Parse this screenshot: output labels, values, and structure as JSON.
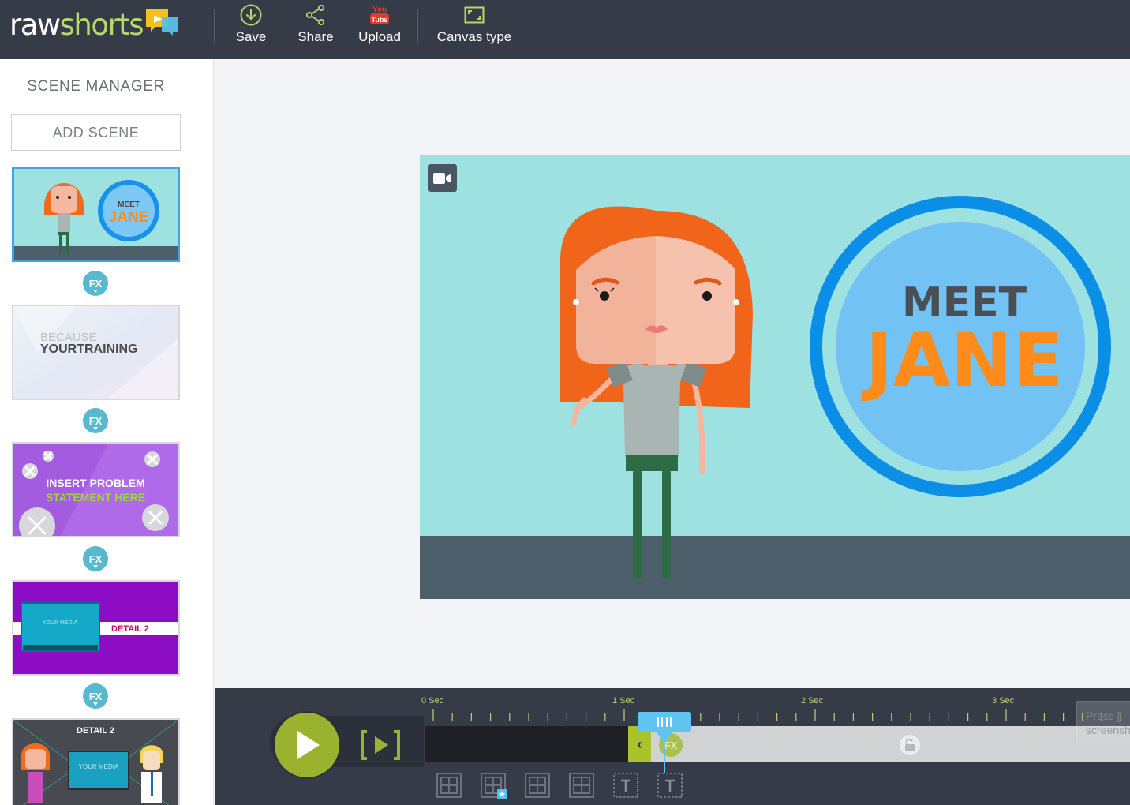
{
  "app": {
    "logo_main": "rawshorts"
  },
  "toolbar": {
    "save_label": "Save",
    "share_label": "Share",
    "upload_label": "Upload",
    "upload_badge": "You Tube",
    "canvas_type_label": "Canvas type",
    "accent_color": "#b8d86a"
  },
  "sidebar": {
    "title": "SCENE MANAGER",
    "add_scene_label": "ADD SCENE",
    "fx_label": "FX",
    "scenes": [
      {
        "thumb_line1": "MEET",
        "thumb_line2": "JANE",
        "selected": true
      },
      {
        "thumb_line1": "BECAUSE",
        "thumb_line2": "YOURTRAINING"
      },
      {
        "thumb_line1": "INSERT PROBLEM",
        "thumb_line2": "STATEMENT HERE"
      },
      {
        "thumb_line1": "YOUR MEDIA",
        "thumb_line2": "DETAIL 2"
      },
      {
        "thumb_line1": "DETAIL 2",
        "thumb_line2": "YOUR MEDIA"
      }
    ]
  },
  "canvas": {
    "headline_small": "MEET",
    "headline_big": "JANE",
    "bg_color": "#9de2e0",
    "floor_color": "#4d5f6b",
    "ring_color": "#0b8fe6",
    "title_color": "#ff8c1a"
  },
  "timeline": {
    "ruler_labels": [
      "0 Sec",
      "1 Sec",
      "2 Sec",
      "3 Sec"
    ],
    "fx_label": "FX",
    "handle_glyph": "‹",
    "tooltip_line1": "Press [",
    "tooltip_line2": "screensh"
  }
}
